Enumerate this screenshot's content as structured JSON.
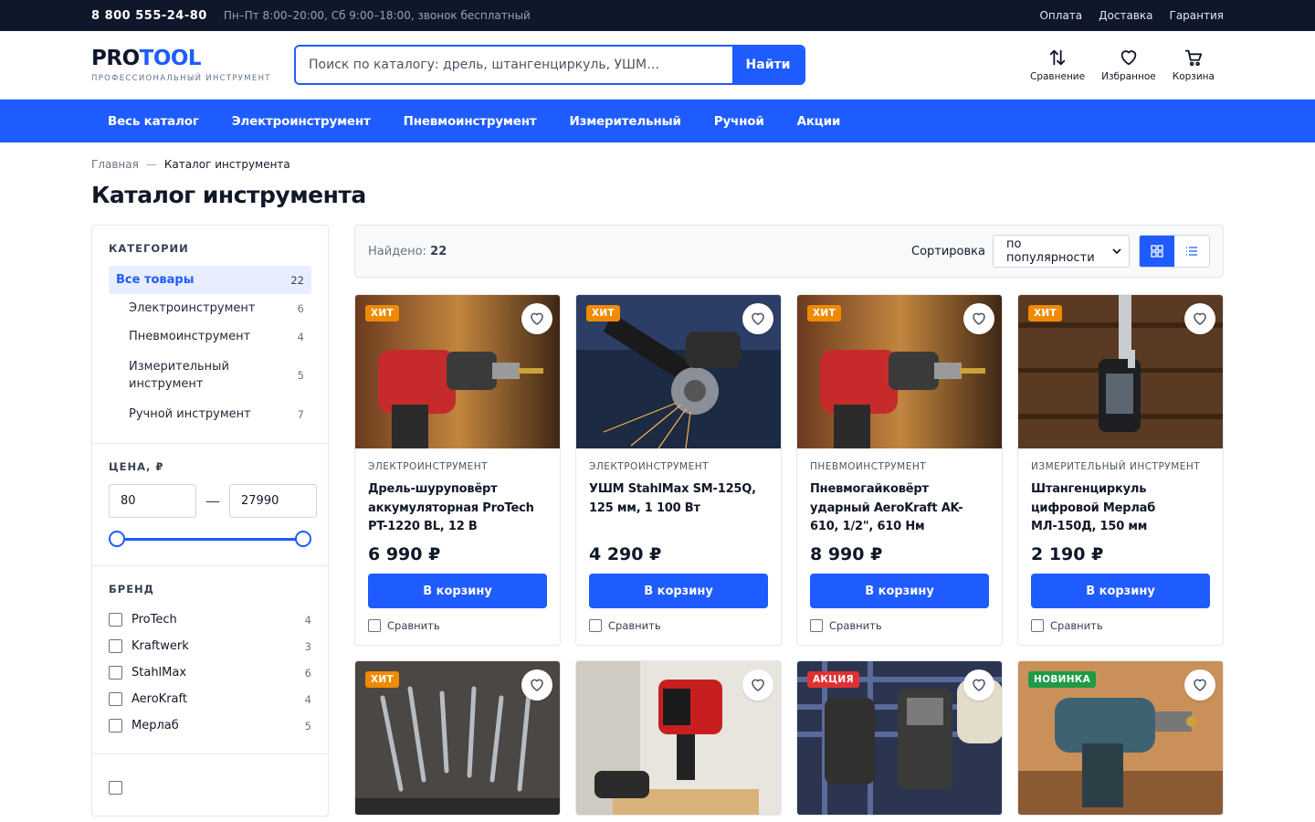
{
  "topbar": {
    "phone": "8 800 555-24-80",
    "hours": "Пн–Пт 8:00–20:00, Сб 9:00–18:00, звонок бесплатный",
    "links": [
      "Оплата",
      "Доставка",
      "Гарантия"
    ]
  },
  "header": {
    "logo_a": "PRO",
    "logo_b": "TOOL",
    "tagline": "ПРОФЕССИОНАЛЬНЫЙ ИНСТРУМЕНТ",
    "search_placeholder": "Поиск по каталогу: дрель, штангенциркуль, УШМ…",
    "search_button": "Найти",
    "compare": "Сравнение",
    "favorites": "Избранное",
    "cart": "Корзина"
  },
  "nav": [
    "Весь каталог",
    "Электроинструмент",
    "Пневмоинструмент",
    "Измерительный",
    "Ручной",
    "Акции"
  ],
  "breadcrumb": {
    "home": "Главная",
    "sep": "—",
    "current": "Каталог инструмента"
  },
  "page_title": "Каталог инструмента",
  "sidebar": {
    "categories_title": "КАТЕГОРИИ",
    "categories": [
      {
        "label": "Все товары",
        "count": "22"
      },
      {
        "label": "Электроинструмент",
        "count": "6"
      },
      {
        "label": "Пневмоинструмент",
        "count": "4"
      },
      {
        "label": "Измерительный инструмент",
        "count": "5"
      },
      {
        "label": "Ручной инструмент",
        "count": "7"
      }
    ],
    "price_title": "ЦЕНА, ₽",
    "price_min": "80",
    "price_max": "27990",
    "price_dash": "—",
    "brand_title": "БРЕНД",
    "brands": [
      {
        "label": "ProTech",
        "count": "4"
      },
      {
        "label": "Kraftwerk",
        "count": "3"
      },
      {
        "label": "StahlMax",
        "count": "6"
      },
      {
        "label": "AeroKraft",
        "count": "4"
      },
      {
        "label": "Мерлаб",
        "count": "5"
      }
    ]
  },
  "toolbar": {
    "found_label": "Найдено:",
    "found_count": "22",
    "sort_label": "Сортировка",
    "sort_value": "по популярности"
  },
  "products": [
    {
      "badge": "ХИТ",
      "category": "ЭЛЕКТРОИНСТРУМЕНТ",
      "title": "Дрель-шуруповёрт аккумуляторная ProTech PT-1220 BL, 12 В",
      "price": "6 990 ₽",
      "button": "В корзину",
      "compare": "Сравнить"
    },
    {
      "badge": "ХИТ",
      "category": "ЭЛЕКТРОИНСТРУМЕНТ",
      "title": "УШМ StahlMax SM-125Q, 125 мм, 1 100 Вт",
      "price": "4 290 ₽",
      "button": "В корзину",
      "compare": "Сравнить"
    },
    {
      "badge": "ХИТ",
      "category": "ПНЕВМОИНСТРУМЕНТ",
      "title": "Пневмогайковёрт ударный AeroKraft AK-610, 1/2\", 610 Нм",
      "price": "8 990 ₽",
      "button": "В корзину",
      "compare": "Сравнить"
    },
    {
      "badge": "ХИТ",
      "category": "ИЗМЕРИТЕЛЬНЫЙ ИНСТРУМЕНТ",
      "title": "Штангенциркуль цифровой Мерлаб МЛ-150Д, 150 мм",
      "price": "2 190 ₽",
      "button": "В корзину",
      "compare": "Сравнить"
    },
    {
      "badge": "ХИТ"
    },
    {
      "badge": ""
    },
    {
      "badge": "АКЦИЯ"
    },
    {
      "badge": "НОВИНКА"
    }
  ],
  "colors": {
    "accent": "#1f5cff",
    "hit": "#f08a00",
    "sale": "#e03131",
    "new": "#1e9b46",
    "topbar": "#0f172a"
  }
}
